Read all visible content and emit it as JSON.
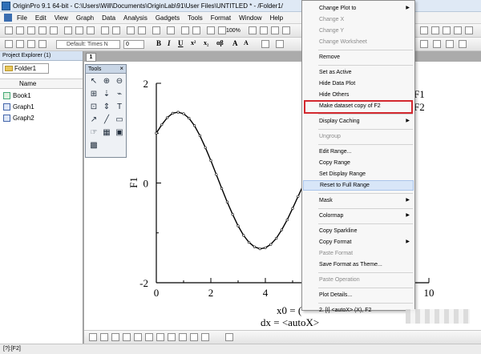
{
  "window": {
    "title": "OriginPro 9.1 64-bit - C:\\Users\\Will\\Documents\\OriginLab\\91\\User Files\\UNTITLED * - /Folder1/"
  },
  "menubar": {
    "items": [
      "File",
      "Edit",
      "View",
      "Graph",
      "Data",
      "Analysis",
      "Gadgets",
      "Tools",
      "Format",
      "Window",
      "Help"
    ]
  },
  "toolbar": {
    "font_name": "Default: Times N",
    "font_size": "0",
    "zoom": "100%"
  },
  "project_explorer": {
    "title": "Project Explorer (1)",
    "folder": "Folder1",
    "column_header": "Name",
    "items": [
      {
        "label": "Book1",
        "icon": "workbook-icon"
      },
      {
        "label": "Graph1",
        "icon": "graph-icon"
      },
      {
        "label": "Graph2",
        "icon": "graph-icon"
      }
    ]
  },
  "graph": {
    "tab_label": "1"
  },
  "tools_panel": {
    "title": "Tools",
    "close": "×",
    "tools": [
      {
        "name": "pointer-tool-icon",
        "glyph": "↖"
      },
      {
        "name": "zoom-in-tool-icon",
        "glyph": "⊕"
      },
      {
        "name": "zoom-out-tool-icon",
        "glyph": "⊖"
      },
      {
        "name": "scale-in-tool-icon",
        "glyph": "⊞"
      },
      {
        "name": "screen-reader-tool-icon",
        "glyph": "⇣"
      },
      {
        "name": "data-selector-tool-icon",
        "glyph": "⌁"
      },
      {
        "name": "data-reader-tool-icon",
        "glyph": "⊡"
      },
      {
        "name": "draw-data-tool-icon",
        "glyph": "⇕"
      },
      {
        "name": "text-tool-icon",
        "glyph": "T"
      },
      {
        "name": "arrow-tool-icon",
        "glyph": "↗"
      },
      {
        "name": "line-tool-icon",
        "glyph": "╱"
      },
      {
        "name": "rectangle-tool-icon",
        "glyph": "▭"
      },
      {
        "name": "region-tool-icon",
        "glyph": "☞"
      },
      {
        "name": "mask-tool-icon",
        "glyph": "▦"
      },
      {
        "name": "image-tool-icon",
        "glyph": "▣"
      },
      {
        "name": "picture-tool-icon",
        "glyph": "▩"
      }
    ]
  },
  "chart_data": {
    "type": "line",
    "x": [
      0,
      0.2,
      0.4,
      0.6,
      0.8,
      1.0,
      1.2,
      1.4,
      1.6,
      1.8,
      2.0,
      2.2,
      2.4,
      2.6,
      2.8,
      3.0,
      3.2,
      3.4,
      3.6,
      3.8,
      4.0,
      4.2,
      4.4,
      4.6,
      4.8,
      5.0,
      5.2,
      5.4,
      5.6,
      5.8,
      6.0,
      6.2,
      6.4
    ],
    "series": [
      {
        "values": [
          1.0,
          1.17,
          1.31,
          1.4,
          1.42,
          1.39,
          1.3,
          1.15,
          0.95,
          0.71,
          0.45,
          0.17,
          -0.11,
          -0.38,
          -0.63,
          -0.86,
          -1.05,
          -1.19,
          -1.28,
          -1.32,
          -1.3,
          -1.23,
          -1.11,
          -0.94,
          -0.74,
          -0.51,
          -0.27,
          -0.03,
          0.21,
          0.43,
          0.62,
          0.78,
          0.9
        ]
      }
    ],
    "xlim": [
      0,
      10
    ],
    "ylim": [
      -2,
      2
    ],
    "xticks": [
      "0",
      "2",
      "4",
      "6",
      "8",
      "10"
    ],
    "yticks": [
      "2",
      "0",
      "-2"
    ],
    "ylabel": "F1",
    "legend_labels": [
      "F1",
      "F2"
    ],
    "annotations": [
      "x0 = (",
      "dx = <autoX>"
    ]
  },
  "context_menu": {
    "items": [
      {
        "label": "Change Plot to",
        "submenu": true
      },
      {
        "label": "Change X",
        "disabled": true
      },
      {
        "label": "Change Y",
        "disabled": true
      },
      {
        "label": "Change Worksheet",
        "disabled": true
      },
      {
        "sep": true
      },
      {
        "label": "Remove"
      },
      {
        "sep": true
      },
      {
        "label": "Set as Active"
      },
      {
        "label": "Hide Data Plot"
      },
      {
        "label": "Hide Others"
      },
      {
        "label": "Make dataset copy of F2"
      },
      {
        "sep": true
      },
      {
        "label": "Display Caching",
        "submenu": true
      },
      {
        "sep": true
      },
      {
        "label": "Ungroup",
        "disabled": true
      },
      {
        "sep": true
      },
      {
        "label": "Edit Range..."
      },
      {
        "label": "Copy Range"
      },
      {
        "label": "Set Display Range"
      },
      {
        "label": "Reset to Full Range",
        "hover": true
      },
      {
        "sep": true
      },
      {
        "label": "Mask",
        "submenu": true
      },
      {
        "sep": true
      },
      {
        "label": "Colormap",
        "submenu": true
      },
      {
        "sep": true
      },
      {
        "label": "Copy Sparkline"
      },
      {
        "label": "Copy Format",
        "submenu": true
      },
      {
        "label": "Paste Format",
        "disabled": true
      },
      {
        "label": "Save Format as Theme..."
      },
      {
        "sep": true
      },
      {
        "label": "Paste Operation",
        "disabled": true
      },
      {
        "sep": true
      },
      {
        "label": "Plot Details..."
      },
      {
        "sep": true
      },
      {
        "label": "2. [I] <autoX> (X), F2"
      }
    ]
  },
  "statusbar": {
    "text": "[?]:[F2]"
  },
  "colors": {
    "highlight_border": "#d3282f",
    "hover_bg": "#d8e6f8",
    "accent": "#2e6fb7"
  }
}
